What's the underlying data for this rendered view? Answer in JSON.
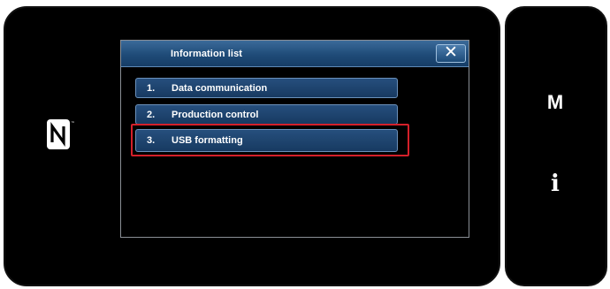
{
  "dialog": {
    "title": "Information list",
    "close_symbol": "✕"
  },
  "menu": {
    "items": [
      {
        "number": "1.",
        "label": "Data communication",
        "highlighted": false
      },
      {
        "number": "2.",
        "label": "Production control",
        "highlighted": false
      },
      {
        "number": "3.",
        "label": "USB formatting",
        "highlighted": true
      }
    ]
  },
  "side_panel": {
    "mode_button": "M",
    "info_button": "i"
  },
  "icons": {
    "nfc": "nfc-icon"
  },
  "colors": {
    "screen_background": "#000000",
    "title_bar": "#1f4b78",
    "button": "#1f4470",
    "highlight": "#d4202a",
    "text": "#ffffff"
  }
}
